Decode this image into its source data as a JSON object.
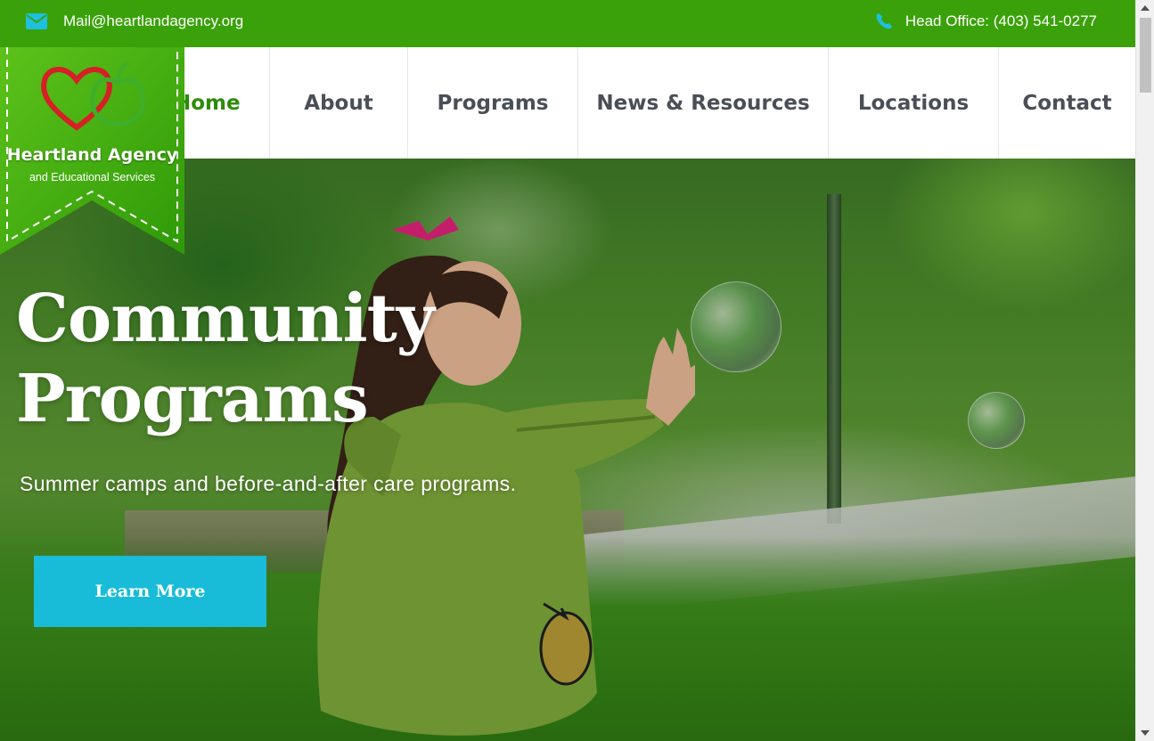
{
  "topbar": {
    "email": "Mail@heartlandagency.org",
    "phone": "Head Office: (403) 541-0277",
    "bg_color": "#3aa10a",
    "icon_color": "#1ec0de"
  },
  "logo": {
    "name": "Heartland Agency",
    "tagline": "and Educational Services"
  },
  "nav": {
    "items": [
      {
        "label": "Home",
        "active": true
      },
      {
        "label": "About"
      },
      {
        "label": "Programs"
      },
      {
        "label": "News & Resources"
      },
      {
        "label": "Locations"
      },
      {
        "label": "Contact"
      }
    ],
    "active_color": "#2e8b0a"
  },
  "hero": {
    "title_line1": "Community",
    "title_line2": "Programs",
    "subtitle": "Summer camps and before-and-after care programs.",
    "button_label": "Learn More",
    "button_color": "#19bcd8"
  },
  "icons": {
    "mail": "envelope-icon",
    "phone": "phone-icon"
  }
}
